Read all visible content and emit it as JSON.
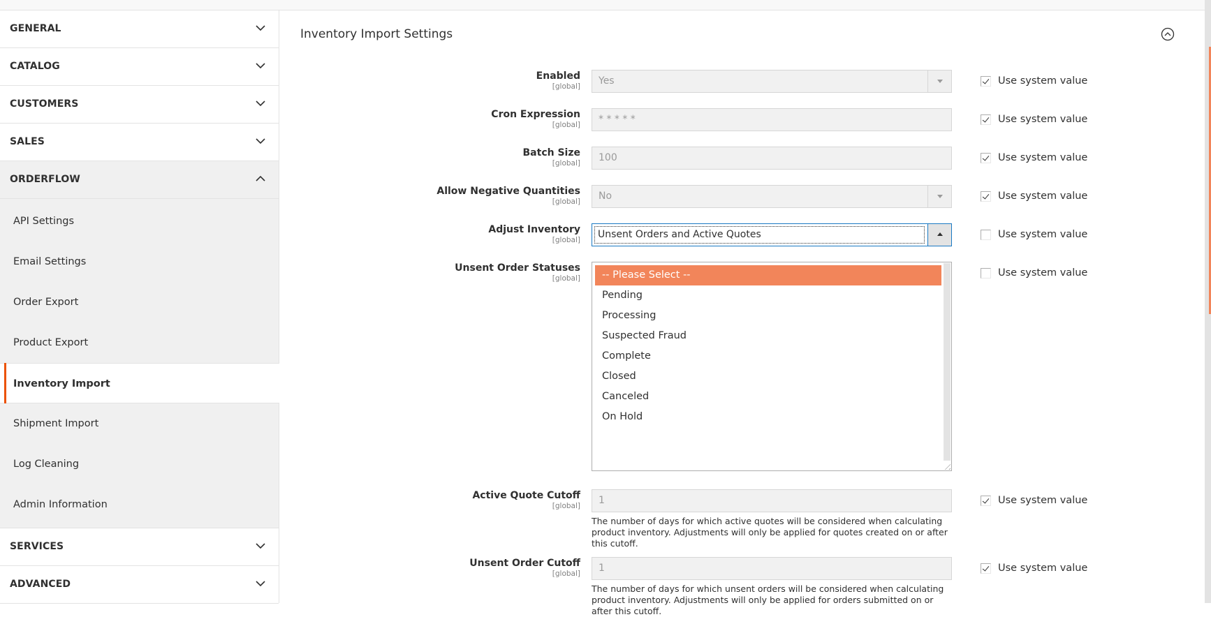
{
  "sidebar": {
    "sections": [
      {
        "label": "GENERAL",
        "expanded": false
      },
      {
        "label": "CATALOG",
        "expanded": false
      },
      {
        "label": "CUSTOMERS",
        "expanded": false
      },
      {
        "label": "SALES",
        "expanded": false
      },
      {
        "label": "ORDERFLOW",
        "expanded": true
      },
      {
        "label": "SERVICES",
        "expanded": false
      },
      {
        "label": "ADVANCED",
        "expanded": false
      }
    ],
    "orderflow_items": [
      {
        "label": "API Settings"
      },
      {
        "label": "Email Settings"
      },
      {
        "label": "Order Export"
      },
      {
        "label": "Product Export"
      },
      {
        "label": "Inventory Import",
        "active": true
      },
      {
        "label": "Shipment Import"
      },
      {
        "label": "Log Cleaning"
      },
      {
        "label": "Admin Information"
      }
    ]
  },
  "main": {
    "title": "Inventory Import Settings",
    "scope_label": "[global]",
    "use_system_value_label": "Use system value",
    "fields": {
      "enabled": {
        "label": "Enabled",
        "value": "Yes",
        "use_system": true
      },
      "cron": {
        "label": "Cron Expression",
        "value": "* * * * *",
        "use_system": true
      },
      "batch_size": {
        "label": "Batch Size",
        "value": "100",
        "use_system": true
      },
      "allow_negative": {
        "label": "Allow Negative Quantities",
        "value": "No",
        "use_system": true
      },
      "adjust_inventory": {
        "label": "Adjust Inventory",
        "value": "Unsent Orders and Active Quotes",
        "use_system": false
      },
      "unsent_statuses": {
        "label": "Unsent Order Statuses",
        "use_system": false,
        "options": [
          "-- Please Select --",
          "Pending",
          "Processing",
          "Suspected Fraud",
          "Complete",
          "Closed",
          "Canceled",
          "On Hold"
        ],
        "highlighted": "-- Please Select --"
      },
      "active_quote_cutoff": {
        "label": "Active Quote Cutoff",
        "value": "1",
        "use_system": true,
        "note": "The number of days for which active quotes will be considered when calculating product inventory. Adjustments will only be applied for quotes created on or after this cutoff."
      },
      "unsent_order_cutoff": {
        "label": "Unsent Order Cutoff",
        "value": "1",
        "use_system": true,
        "note": "The number of days for which unsent orders will be considered when calculating product inventory. Adjustments will only be applied for orders submitted on or after this cutoff."
      }
    }
  },
  "colors": {
    "accent": "#eb5202",
    "highlight": "#f2855a",
    "focus": "#1979c3"
  }
}
